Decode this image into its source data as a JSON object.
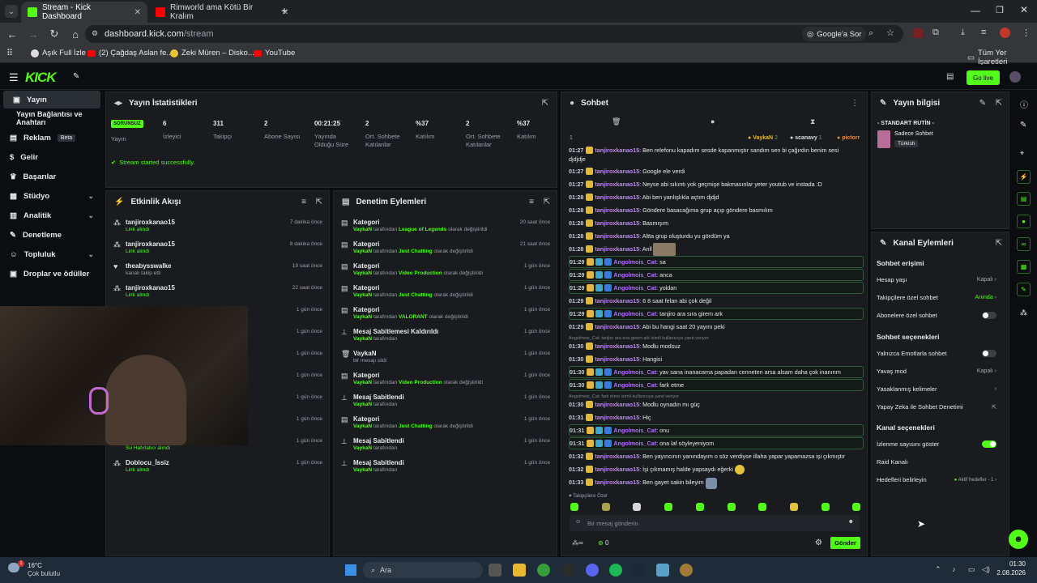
{
  "browser": {
    "tabs": [
      {
        "label": "Stream - Kick Dashboard",
        "active": true
      },
      {
        "label": "Rimworld ama Kötü Bir Kralım",
        "active": false
      }
    ],
    "url_host": "dashboard.kick.com",
    "url_path": "/stream",
    "search_chip": "Google'a Sor",
    "bookmarks": [
      "Aşık Full İzle",
      "(2) Çağdaş Aslan fe...",
      "Zeki Müren – Disko...",
      "YouTube"
    ],
    "all_bookmarks": "Tüm Yer İşaretleri"
  },
  "header": {
    "logo": "KICK",
    "go_live": "Go live"
  },
  "sidebar": {
    "items": [
      {
        "label": "Yayın",
        "active": true
      },
      {
        "label": "Yayın Bağlantısı ve Anahtarı"
      },
      {
        "label": "Reklam",
        "badge": "Beta"
      },
      {
        "label": "Gelir"
      },
      {
        "label": "Başarılar"
      },
      {
        "label": "Stüdyo",
        "chevron": true
      },
      {
        "label": "Analitik",
        "chevron": true
      },
      {
        "label": "Denetleme"
      },
      {
        "label": "Topluluk",
        "chevron": true
      },
      {
        "label": "Droplar ve ödüller"
      }
    ]
  },
  "stats": {
    "title": "Yayın İstatistikleri",
    "status": "SORUNSUZ",
    "status_label": "Yayın",
    "items": [
      {
        "value": "6",
        "label": "İzleyici"
      },
      {
        "value": "311",
        "label": "Takipçi"
      },
      {
        "value": "2",
        "label": "Abone Sayısı"
      },
      {
        "value": "00:21:25",
        "label": "Yayında Olduğu Süre"
      },
      {
        "value": "2",
        "label": "Ort. Sohbete Katılanlar"
      },
      {
        "value": "%37",
        "label": "Katılım"
      },
      {
        "value": "2",
        "label": "Ort. Sohbete Katılanlar"
      },
      {
        "value": "%37",
        "label": "Katılım"
      }
    ],
    "success": "Stream started successfully."
  },
  "activity": {
    "title": "Etkinlik Akışı",
    "items": [
      {
        "name": "tanjiroxkanao15",
        "desc": "Link alındı",
        "time": "7 dakika önce"
      },
      {
        "name": "tanjiroxkanao15",
        "desc": "Link alındı",
        "time": "8 dakika önce"
      },
      {
        "name": "theabysswalke",
        "desc": "kanalı takip etti",
        "time": "19 saat önce"
      },
      {
        "name": "tanjiroxkanao15",
        "desc": "Link alındı",
        "time": "22 saat önce"
      },
      {
        "name": "",
        "desc": "",
        "time": "1 gün önce"
      },
      {
        "name": "",
        "desc": "",
        "time": "1 gün önce"
      },
      {
        "name": "",
        "desc": "",
        "time": "1 gün önce"
      },
      {
        "name": "",
        "desc": "",
        "time": "1 gün önce"
      },
      {
        "name": "",
        "desc": "",
        "time": "1 gün önce"
      },
      {
        "name": "",
        "desc": "",
        "time": "1 gün önce"
      },
      {
        "name": "",
        "desc": "Su Hatırlatıcı alındı",
        "time": "1 gün önce"
      },
      {
        "name": "Doblocu_İssiz",
        "desc": "Link alındı",
        "time": "1 gün önce"
      }
    ]
  },
  "moderation": {
    "title": "Denetim Eylemleri",
    "items": [
      {
        "title": "Kategori",
        "by": "VaykaN",
        "mid": " tarafından ",
        "val": "League of Legends",
        "tail": " olarak değiştirildi",
        "time": "20 saat önce"
      },
      {
        "title": "Kategori",
        "by": "VaykaN",
        "mid": " tarafından ",
        "val": "Just Chatting",
        "tail": " olarak değiştirildi",
        "time": "21 saat önce"
      },
      {
        "title": "Kategori",
        "by": "VaykaN",
        "mid": " tarafından ",
        "val": "Video Production",
        "tail": " olarak değiştirildi",
        "time": "1 gün önce"
      },
      {
        "title": "Kategori",
        "by": "VaykaN",
        "mid": " tarafından ",
        "val": "Just Chatting",
        "tail": " olarak değiştirildi",
        "time": "1 gün önce"
      },
      {
        "title": "Kategori",
        "by": "VaykaN",
        "mid": " tarafından ",
        "val": "VALORANT",
        "tail": " olarak değiştirildi",
        "time": "1 gün önce"
      },
      {
        "title": "Mesaj Sabitlemesi Kaldırıldı",
        "by": "VaykaN",
        "mid": " tarafından",
        "val": "",
        "tail": "",
        "time": "1 gün önce"
      },
      {
        "title": "VaykaN",
        "by": "",
        "mid": "bir mesajı sildi",
        "val": "",
        "tail": "",
        "time": "1 gün önce"
      },
      {
        "title": "Kategori",
        "by": "VaykaN",
        "mid": " tarafından ",
        "val": "Video Production",
        "tail": " olarak değiştirildi",
        "time": "1 gün önce"
      },
      {
        "title": "Mesaj Sabitlendi",
        "by": "VaykaN",
        "mid": " tarafından",
        "val": "",
        "tail": "",
        "time": "1 gün önce"
      },
      {
        "title": "Kategori",
        "by": "VaykaN",
        "mid": " tarafından ",
        "val": "Just Chatting",
        "tail": " olarak değiştirildi",
        "time": "1 gün önce"
      },
      {
        "title": "Mesaj Sabitlendi",
        "by": "VaykaN",
        "mid": " tarafından",
        "val": "",
        "tail": "",
        "time": "1 gün önce"
      },
      {
        "title": "Mesaj Sabitlendi",
        "by": "VaykaN",
        "mid": " tarafından",
        "val": "",
        "tail": "",
        "time": "1 gün önce"
      }
    ]
  },
  "chat": {
    "title": "Sohbet",
    "leaderboard": [
      {
        "name": "VaykaN",
        "count": "2"
      },
      {
        "name": "scanavy",
        "count": "1"
      },
      {
        "name": "pictorr",
        "count": ""
      }
    ],
    "first_index": "1",
    "messages": [
      {
        "time": "01:27",
        "user": "tanjiroxkanao15",
        "text": ": Ben relefonu kapadım sesde kapanmıştır sandım sen bi çağırdın benim sesi",
        "hl": false
      },
      {
        "time": "",
        "user": "",
        "text": "djdjdje",
        "hl": false
      },
      {
        "time": "01:27",
        "user": "tanjiroxkanao15",
        "text": ": Google ele verdi",
        "hl": false
      },
      {
        "time": "01:27",
        "user": "tanjiroxkanao15",
        "text": ": Neyse abi sıkıntı yok geçmişe bakmasınlar yeter youtub ve instada :D",
        "hl": false
      },
      {
        "time": "01:28",
        "user": "tanjiroxkanao15",
        "text": ": Abi ben yanlışlıkla açtım djdjd",
        "hl": false
      },
      {
        "time": "01:28",
        "user": "tanjiroxkanao15",
        "text": ": Göndere basacağıma grup açıp göndere basmılım",
        "hl": false
      },
      {
        "time": "01:28",
        "user": "tanjiroxkanao15",
        "text": ": Basmışım",
        "hl": false
      },
      {
        "time": "01:28",
        "user": "tanjiroxkanao15",
        "text": ": Altta grup oluşturdu yu gördüm ya",
        "hl": false
      },
      {
        "time": "01:28",
        "user": "tanjiroxkanao15",
        "text": ": Anll",
        "hl": false
      },
      {
        "time": "01:29",
        "user": "Angolmois_Cat",
        "text": ": sa",
        "hl": true
      },
      {
        "time": "01:29",
        "user": "Angolmois_Cat",
        "text": ": anca",
        "hl": true
      },
      {
        "time": "01:29",
        "user": "Angolmois_Cat",
        "text": ": yoldan",
        "hl": true
      },
      {
        "time": "01:29",
        "user": "tanjiroxkanao15",
        "text": ": 6 8 saat felan abi çok değil",
        "hl": false
      },
      {
        "time": "01:29",
        "user": "Angolmois_Cat",
        "text": ": tanjiro ara sıra girem ark",
        "hl": true
      },
      {
        "time": "01:29",
        "user": "tanjiroxkanao15",
        "text": ": Abi bu hangi saat 20 yayını peki",
        "hl": false
      },
      {
        "time": "01:30",
        "user": "tanjiroxkanao15",
        "text": ": Modlu modsuz",
        "hl": false
      },
      {
        "time": "01:30",
        "user": "tanjiroxkanao15",
        "text": ": Hangisi",
        "hl": false
      },
      {
        "time": "01:30",
        "user": "Angolmois_Cat",
        "text": ": yav sana inanacama papadan cenneten arsa alsam daha çok inanırım",
        "hl": true
      },
      {
        "time": "01:30",
        "user": "Angolmois_Cat",
        "text": ": fark etme",
        "hl": true
      },
      {
        "time": "01:30",
        "user": "tanjiroxkanao15",
        "text": ": Modlu oynadın mı güç",
        "hl": false
      },
      {
        "time": "01:31",
        "user": "tanjiroxkanao15",
        "text": ": Hiç",
        "hl": false
      },
      {
        "time": "01:31",
        "user": "Angolmois_Cat",
        "text": ": onu",
        "hl": true
      },
      {
        "time": "01:31",
        "user": "Angolmois_Cat",
        "text": ": ona laf söyleyeniyom",
        "hl": true
      },
      {
        "time": "01:32",
        "user": "tanjiroxkanao15",
        "text": ": Ben yayıncının yanındayım o söz verdiyse illaha yapar yapamazsa işi çıkmıştır",
        "hl": false
      },
      {
        "time": "01:32",
        "user": "tanjiroxkanao15",
        "text": ": İşi çıkmamış halde yapsaydı eğerki",
        "hl": false
      },
      {
        "time": "01:33",
        "user": "tanjiroxkanao15",
        "text": ": Ben gayet sakin bileyim",
        "hl": false
      }
    ],
    "reply1": "Angolmois_Cat: tanjiro ara sıra girem ark isimli kullanıcıya yanıt veriyor",
    "reply2": "Angolmois_Cat: fark etme isimli kullanıcıya yanıt veriyor",
    "followers_only": "Takipçilere Özel",
    "input_placeholder": "Bir mesaj gönderin",
    "points": "0",
    "send": "Gönder"
  },
  "stream_info": {
    "title": "Yayın bilgisi",
    "routine": "- STANDART RUTİN -",
    "category": "Sadece Sohbet",
    "language": "Türkish"
  },
  "channel_actions": {
    "title": "Kanal Eylemleri",
    "chat_access": "Sohbet erişimi",
    "account_age": "Hesap yaşı",
    "account_age_val": "Kapalı",
    "followers_chat": "Takipçilere özel sohbet",
    "followers_chat_val": "Anında",
    "subs_chat": "Abonelere özel sohbet",
    "chat_options": "Sohbet seçenekleri",
    "emotes_only": "Yalnızca Emotlarla sohbet",
    "slow_mode": "Yavaş mod",
    "slow_mode_val": "Kapalı",
    "banned_words": "Yasaklanmış kelimeler",
    "ai_mod": "Yapay Zeka ile Sohbet Denetimi",
    "channel_options": "Kanal seçenekleri",
    "show_viewers": "İzlenme sayısını göster",
    "raid": "Raid Kanalı",
    "goals": "Hedefleri belirleyin",
    "goals_val": "Aktif hedefler - 1"
  },
  "taskbar": {
    "weather_temp": "16°C",
    "weather_desc": "Çok bulutlu",
    "search": "Ara",
    "time": "01:30",
    "date": "2.08.2026",
    "badge": "1"
  },
  "colors": {
    "accent": "#53fc18",
    "panel": "#191b1f",
    "bg": "#0b0d0f",
    "cat_user": "#b46cff",
    "tanjiro": "#c084fc"
  }
}
